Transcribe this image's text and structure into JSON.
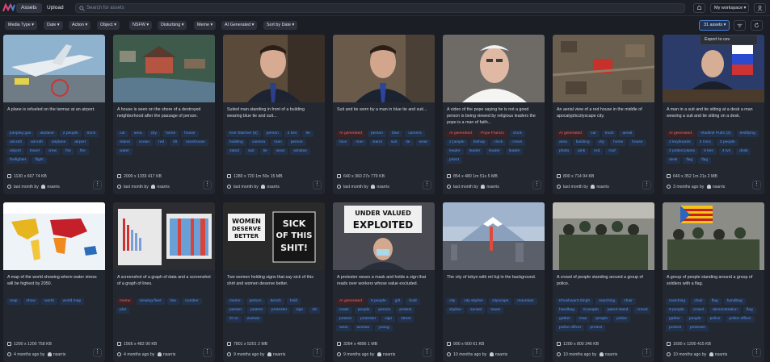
{
  "topbar": {
    "tabs": [
      {
        "label": "Assets",
        "active": true
      },
      {
        "label": "Upload",
        "active": false
      }
    ],
    "search_placeholder": "Search for assets",
    "workspace_label": "My workspace ▾",
    "icons": [
      "logo-icon",
      "search-icon",
      "bell-icon",
      "user-icon"
    ]
  },
  "filters": [
    "Media Type ▾",
    "Date ▾",
    "Action ▾",
    "Object ▾",
    "NSFW ▾",
    "Disturbing ▾",
    "Meme ▾",
    "AI Generated ▾",
    "Sort by Date ▾"
  ],
  "assets_count_label": "31 assets ▾",
  "export_label": "Export to csv",
  "colors": {
    "accent": "#4a7fd6",
    "ai_tag": "#e06a6f",
    "tag": "#5e93e0",
    "card": "#232730",
    "bg": "#1b1e25"
  },
  "cards": [
    {
      "desc": "A plane is refueled on the tarmac at an airport.",
      "tags": [
        [
          "jumping gas",
          0
        ],
        [
          "airplane",
          0
        ],
        [
          "2 people",
          0
        ],
        [
          "truck",
          0
        ],
        [
          "aircraft",
          0
        ],
        [
          "aircraft",
          0
        ],
        [
          "airplane",
          0
        ],
        [
          "airport",
          0
        ],
        [
          "airport",
          0
        ],
        [
          "travel",
          0
        ],
        [
          "crew",
          0
        ],
        [
          "fire",
          0
        ],
        [
          "fire",
          0
        ],
        [
          "firefighter",
          0
        ],
        [
          "flight",
          0
        ]
      ],
      "meta": "1130 x 667  74 KB",
      "time": "last month",
      "user": "nsarris"
    },
    {
      "desc": "A house is seen on the shore of a destroyed neighborhood after the passage of person.",
      "tags": [
        [
          "car",
          0
        ],
        [
          "area",
          0
        ],
        [
          "city",
          0
        ],
        [
          "home",
          0
        ],
        [
          "house",
          0
        ],
        [
          "island",
          0
        ],
        [
          "ocean",
          0
        ],
        [
          "red",
          0
        ],
        [
          "tilt",
          0
        ],
        [
          "townhouse",
          0
        ],
        [
          "water",
          0
        ]
      ],
      "meta": "2000 x 1333  417 KB",
      "time": "last month",
      "user": "nsarris"
    },
    {
      "desc": "Suited man standing in front of a building wearing blue tie and suit...",
      "tags": [
        [
          "Keir Starmer (6)",
          0
        ],
        [
          "person",
          0
        ],
        [
          "2 ties",
          0
        ],
        [
          "tie",
          0
        ],
        [
          "building",
          0
        ],
        [
          "camera",
          0
        ],
        [
          "man",
          0
        ],
        [
          "person",
          0
        ],
        [
          "stand",
          0
        ],
        [
          "suit",
          0
        ],
        [
          "tie",
          0
        ],
        [
          "wear",
          0
        ],
        [
          "window",
          0
        ]
      ],
      "meta": "1280 x 720  1m 50s  15 MB",
      "time": "last month",
      "user": "nsarris"
    },
    {
      "desc": "Suit and tie worn by a man in blue tie and suit...",
      "tags": [
        [
          "AI generated",
          1
        ],
        [
          "person",
          0
        ],
        [
          "blue",
          0
        ],
        [
          "camera",
          0
        ],
        [
          "face",
          0
        ],
        [
          "man",
          0
        ],
        [
          "stand",
          0
        ],
        [
          "suit",
          0
        ],
        [
          "tie",
          0
        ],
        [
          "wear",
          0
        ]
      ],
      "meta": "640 x 360  27s  779 KB",
      "time": "last month",
      "user": "nsarris"
    },
    {
      "desc": "A video of the pope saying he is not a good person is being viewed by religious leaders the pope is a man of faith...",
      "tags": [
        [
          "AI generated",
          1
        ],
        [
          "Pope Francis",
          1
        ],
        [
          "clock",
          0
        ],
        [
          "2 people",
          0
        ],
        [
          "bishop",
          0
        ],
        [
          "clock",
          0
        ],
        [
          "crown",
          0
        ],
        [
          "leader",
          0
        ],
        [
          "leader",
          0
        ],
        [
          "leader",
          0
        ],
        [
          "leader",
          0
        ],
        [
          "priest",
          0
        ]
      ],
      "meta": "854 x 480  1m 51s  5 MB",
      "time": "last month",
      "user": "nsarris"
    },
    {
      "desc": "An aerial view of a red house in the middle of apocalypticcityscape city.",
      "tags": [
        [
          "AI generated",
          1
        ],
        [
          "car",
          0
        ],
        [
          "truck",
          0
        ],
        [
          "aerial",
          0
        ],
        [
          "area",
          0
        ],
        [
          "building",
          0
        ],
        [
          "city",
          0
        ],
        [
          "home",
          0
        ],
        [
          "house",
          0
        ],
        [
          "photo",
          0
        ],
        [
          "pink",
          0
        ],
        [
          "red",
          0
        ],
        [
          "roof",
          0
        ]
      ],
      "meta": "800 x 714  94 KB",
      "time": "last month",
      "user": "nsarris"
    },
    {
      "desc": "A man in a suit and tie sitting at a desk a man wearing a suit and tie sitting on a desk.",
      "tags": [
        [
          "AI generated",
          1
        ],
        [
          "Vladimir Putin (2)",
          0
        ],
        [
          "testifying",
          0
        ],
        [
          "2 keyboards",
          0
        ],
        [
          "2 mics",
          0
        ],
        [
          "3 people",
          0
        ],
        [
          "2 potted plants",
          0
        ],
        [
          "5 ties",
          0
        ],
        [
          "4 tvs",
          0
        ],
        [
          "desk",
          0
        ],
        [
          "desk",
          0
        ],
        [
          "flag",
          0
        ],
        [
          "flag",
          0
        ]
      ],
      "meta": "640 x 352  1m 21s  2 MB",
      "time": "3 months ago",
      "user": "nsarris"
    },
    {
      "desc": "A map of the world showing where water stress will be highest by 2050.",
      "tags": [
        [
          "map",
          0
        ],
        [
          "show",
          0
        ],
        [
          "world",
          0
        ],
        [
          "world map",
          0
        ]
      ],
      "meta": "1200 x 1200  758 KB",
      "time": "4 months ago",
      "user": "nsarris"
    },
    {
      "desc": "A screenshot of a graph of data and a screenshot of a graph of lines.",
      "tags": [
        [
          "meme",
          1
        ],
        [
          "viewing fleet",
          0
        ],
        [
          "line",
          0
        ],
        [
          "number",
          0
        ],
        [
          "plot",
          0
        ]
      ],
      "meta": "1566 x 482  90 KB",
      "time": "4 months ago",
      "user": "nsarris"
    },
    {
      "desc": "Two women holding signs that say sick of this shirt and women deserve better.",
      "tags": [
        [
          "meme",
          0
        ],
        [
          "person",
          0
        ],
        [
          "bench",
          0
        ],
        [
          "hold",
          0
        ],
        [
          "person",
          0
        ],
        [
          "protest",
          0
        ],
        [
          "protester",
          0
        ],
        [
          "sign",
          0
        ],
        [
          "shi",
          0
        ],
        [
          "tit no",
          0
        ],
        [
          "woman",
          0
        ]
      ],
      "meta": "7801 x 5201  2 MB",
      "time": "9 months ago",
      "user": "nsarris"
    },
    {
      "desc": "A protester wears a mask and holds a sign that reads over workers whose value excluded.",
      "tags": [
        [
          "AI generated",
          1
        ],
        [
          "5 people",
          0
        ],
        [
          "girl",
          0
        ],
        [
          "hold",
          0
        ],
        [
          "mask",
          0
        ],
        [
          "people",
          0
        ],
        [
          "person",
          0
        ],
        [
          "protest",
          0
        ],
        [
          "protest",
          0
        ],
        [
          "protester",
          0
        ],
        [
          "sign",
          0
        ],
        [
          "street",
          0
        ],
        [
          "wear",
          0
        ],
        [
          "woman",
          0
        ],
        [
          "young",
          0
        ]
      ],
      "meta": "3264 x 4896  1 MB",
      "time": "9 months ago",
      "user": "nsarris"
    },
    {
      "desc": "The city of tokyo with mt fuji in the background.",
      "tags": [
        [
          "city",
          0
        ],
        [
          "city skyline",
          0
        ],
        [
          "cityscape",
          0
        ],
        [
          "mountain",
          0
        ],
        [
          "skyline",
          0
        ],
        [
          "sunset",
          0
        ],
        [
          "tower",
          0
        ]
      ],
      "meta": "900 x 600  61 KB",
      "time": "10 months ago",
      "user": "nsarris"
    },
    {
      "desc": "A crowd of people standing around a group of police.",
      "tags": [
        [
          "Khushwant Singh",
          0
        ],
        [
          "marching",
          0
        ],
        [
          "chair",
          0
        ],
        [
          "handbag",
          0
        ],
        [
          "8 people",
          0
        ],
        [
          "patrol stand",
          0
        ],
        [
          "crowd",
          0
        ],
        [
          "gather",
          0
        ],
        [
          "man",
          0
        ],
        [
          "people",
          0
        ],
        [
          "police",
          0
        ],
        [
          "police officer",
          0
        ],
        [
          "protest",
          0
        ]
      ],
      "meta": "1200 x 800  246 KB",
      "time": "10 months ago",
      "user": "nsarris"
    },
    {
      "desc": "A group of people standing around a group of soldiers with a flag.",
      "tags": [
        [
          "marching",
          0
        ],
        [
          "chair",
          0
        ],
        [
          "flag",
          0
        ],
        [
          "handbag",
          0
        ],
        [
          "8 people",
          0
        ],
        [
          "crowd",
          0
        ],
        [
          "demonstration",
          0
        ],
        [
          "flag",
          0
        ],
        [
          "gather",
          0
        ],
        [
          "people",
          0
        ],
        [
          "police",
          0
        ],
        [
          "police officer",
          0
        ],
        [
          "protest",
          0
        ],
        [
          "protester",
          0
        ]
      ],
      "meta": "1600 x 1200  415 KB",
      "time": "10 months ago",
      "user": "nsarris"
    }
  ]
}
